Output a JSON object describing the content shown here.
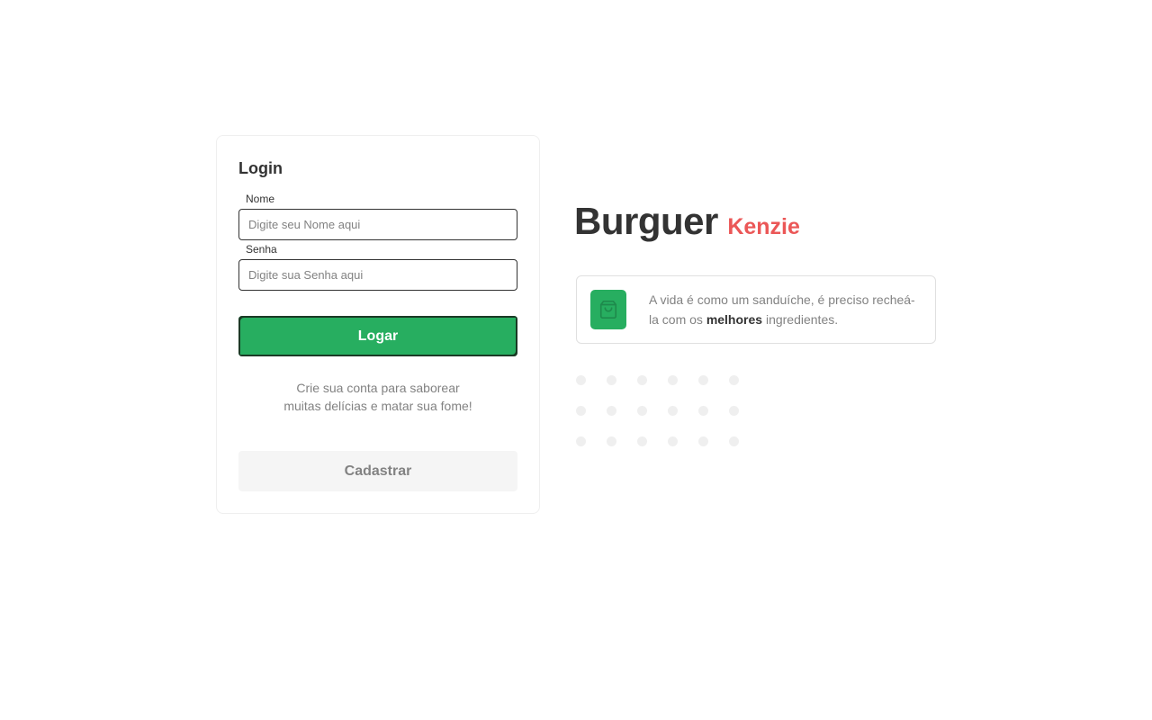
{
  "login": {
    "title": "Login",
    "name_label": "Nome",
    "name_placeholder": "Digite seu Nome aqui",
    "name_value": "",
    "password_label": "Senha",
    "password_placeholder": "Digite sua Senha aqui",
    "password_value": "",
    "submit_label": "Logar",
    "signup_text": "Crie sua conta para saborear muitas delícias e matar sua fome!",
    "signup_label": "Cadastrar"
  },
  "brand": {
    "name": "Burguer",
    "suffix": "Kenzie"
  },
  "info": {
    "icon": "shopping-bag-icon",
    "text_before": "A vida é como um sanduíche, é preciso recheá-la com os",
    "text_bold": "melhores",
    "text_after": "ingredientes."
  },
  "colors": {
    "primary": "#27ae60",
    "secondary": "#eb5757",
    "text": "#333333",
    "muted": "#828282"
  }
}
